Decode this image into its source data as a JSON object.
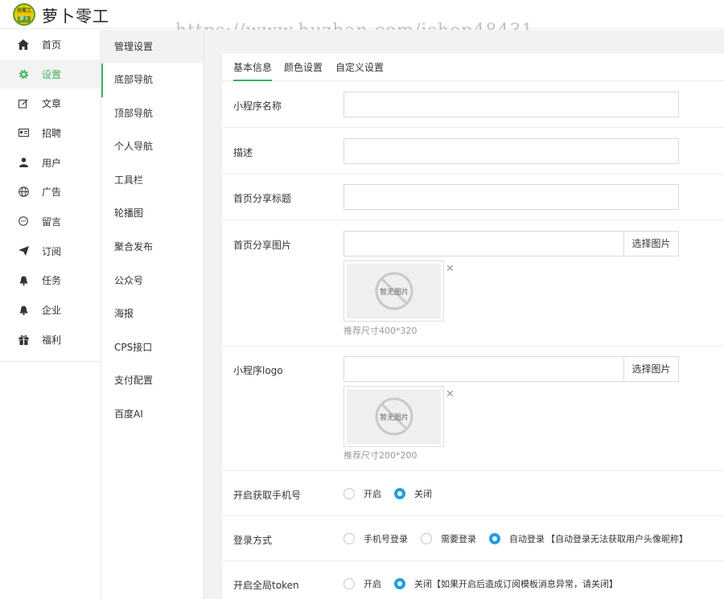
{
  "brand": {
    "name": "萝卜零工",
    "badge_top": "找零工",
    "badge_bottom": "萝卜"
  },
  "watermark": "https://www.huzhan.com/ishop48431",
  "nav": {
    "items": [
      {
        "label": "首页",
        "icon": "home-icon"
      },
      {
        "label": "设置",
        "icon": "gear-icon",
        "active": true
      },
      {
        "label": "文章",
        "icon": "edit-icon"
      },
      {
        "label": "招聘",
        "icon": "id-card-icon"
      },
      {
        "label": "用户",
        "icon": "user-icon"
      },
      {
        "label": "广告",
        "icon": "globe-icon"
      },
      {
        "label": "留言",
        "icon": "chat-icon"
      },
      {
        "label": "订阅",
        "icon": "send-icon"
      },
      {
        "label": "任务",
        "icon": "bell-icon"
      },
      {
        "label": "企业",
        "icon": "bell-icon"
      },
      {
        "label": "福利",
        "icon": "gift-icon"
      }
    ]
  },
  "subnav": {
    "title": "管理设置",
    "items": [
      "底部导航",
      "顶部导航",
      "个人导航",
      "工具栏",
      "轮播图",
      "聚合发布",
      "公众号",
      "海报",
      "CPS接口",
      "支付配置",
      "百度AI"
    ]
  },
  "tabs": [
    "基本信息",
    "颜色设置",
    "自定义设置"
  ],
  "form": {
    "app_name_label": "小程序名称",
    "desc_label": "描述",
    "share_title_label": "首页分享标题",
    "share_image_label": "首页分享图片",
    "pick_image": "选择图片",
    "no_image": "暂无图片",
    "share_image_hint": "推荐尺寸400*320",
    "logo_label": "小程序logo",
    "logo_hint": "推荐尺寸200*200",
    "phone_label": "开启获取手机号",
    "phone_opts": [
      "开启",
      "关闭"
    ],
    "login_label": "登录方式",
    "login_opts": [
      "手机号登录",
      "需要登录",
      "自动登录"
    ],
    "login_note": "【自动登录无法获取用户头像昵称】",
    "token_label": "开启全局token",
    "token_opts": [
      "开启",
      "关闭"
    ],
    "token_note": "【如果开启后造成订阅模板消息异常，请关闭】"
  },
  "colors": {
    "accent": "#3bb35b",
    "radio": "#1e9fe0"
  }
}
